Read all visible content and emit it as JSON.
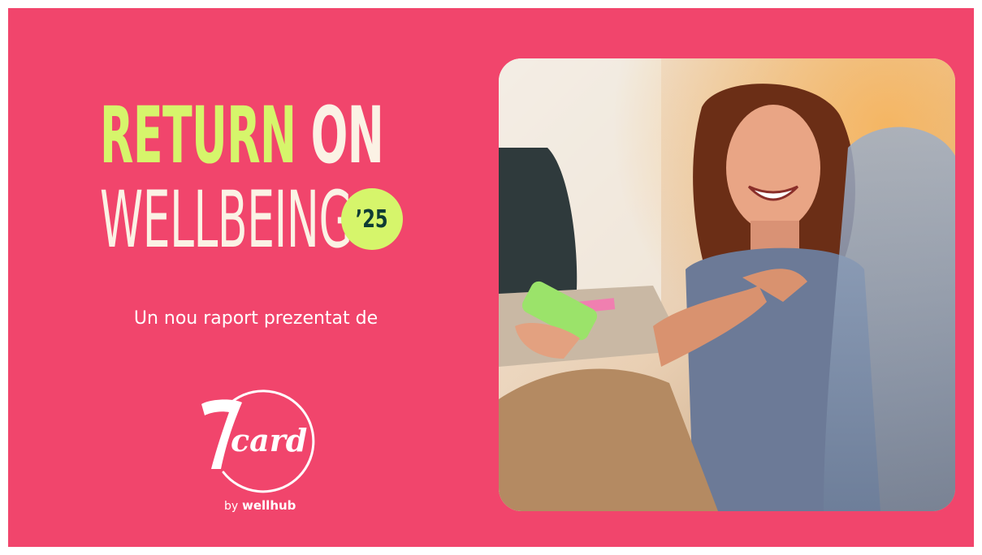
{
  "headline": {
    "line1_word1": "RETURN",
    "line1_word2": "ON",
    "line2": "WELLBEING",
    "year_badge": "’25"
  },
  "subtitle": "Un nou raport prezentat de",
  "logo": {
    "brand_mark": "7card",
    "tagline_prefix": "by",
    "tagline_brand": "wellhub"
  },
  "colors": {
    "background": "#f1456c",
    "accent_lime": "#d6f56b",
    "cream": "#fbf2e5",
    "badge_text": "#0e3b34"
  },
  "photo": {
    "icon": "photo-of-smiling-woman-holding-phone"
  }
}
